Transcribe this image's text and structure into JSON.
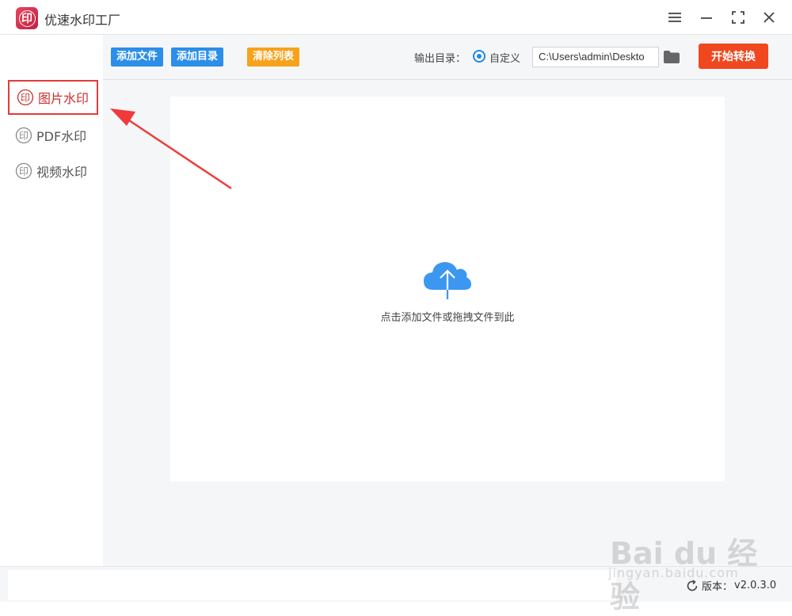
{
  "app": {
    "title": "优速水印工厂",
    "logo_glyph": "印"
  },
  "window_controls": {
    "menu": "menu-icon",
    "minimize": "minimize-icon",
    "maximize": "maximize-icon",
    "close": "close-icon"
  },
  "sidebar": {
    "items": [
      {
        "label": "图片水印",
        "active": true,
        "glyph": "印"
      },
      {
        "label": "PDF水印",
        "active": false,
        "glyph": "印"
      },
      {
        "label": "视频水印",
        "active": false,
        "glyph": "印"
      }
    ]
  },
  "toolbar": {
    "add_file": "添加文件",
    "add_folder": "添加目录",
    "clear_list": "清除列表",
    "output_label": "输出目录：",
    "custom_option": "自定义",
    "output_path": "C:\\Users\\admin\\Deskto",
    "start": "开始转换"
  },
  "dropzone": {
    "hint": "点击添加文件或拖拽文件到此"
  },
  "status": {
    "version_label": "版本：",
    "version": "v2.0.3.0"
  },
  "watermark": {
    "brand": "Bai du 经验",
    "site": "jingyan.baidu.com"
  },
  "colors": {
    "blue_button": "#2b8ee8",
    "orange_button": "#f7a21b",
    "start_button": "#f0471f",
    "active_border": "#e23b3b",
    "cloud": "#3b97f0"
  }
}
